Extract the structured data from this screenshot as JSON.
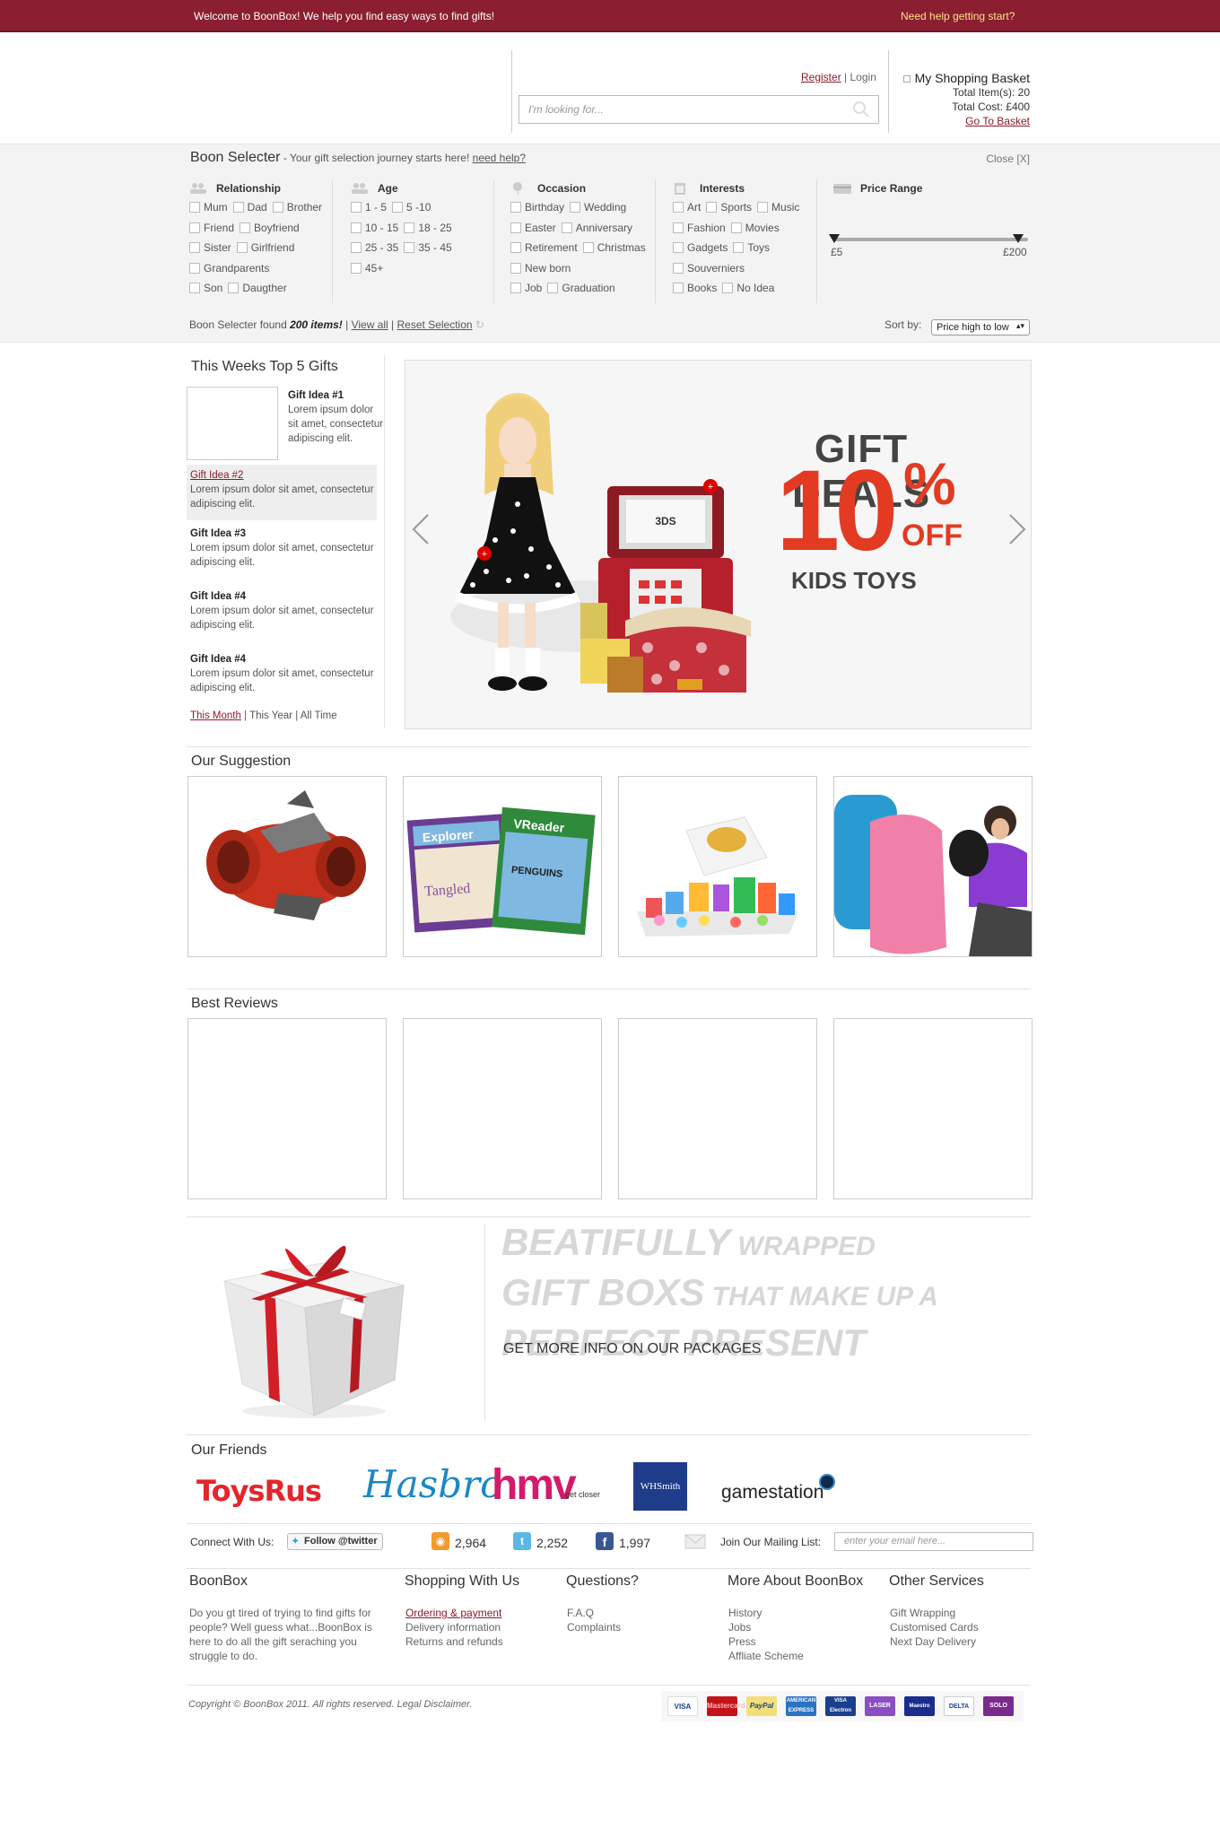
{
  "topbar": {
    "welcome": "Welcome to BoonBox! We help you find easy ways to find gifts!",
    "help": "Need help getting start?"
  },
  "header": {
    "search_placeholder": "I'm looking for...",
    "register": "Register",
    "divider": "|",
    "login": "Login",
    "basket": {
      "title": "My Shopping Basket",
      "items": "Total Item(s): 20",
      "cost": "Total Cost: £400",
      "link": "Go To Basket"
    }
  },
  "selector": {
    "title": "Boon Selecter",
    "subtitle": " - Your gift selection journey starts here! ",
    "help_link": "need help?",
    "close": "Close [X]",
    "relationship": {
      "label": "Relationship",
      "rows": [
        [
          "Mum",
          "Dad",
          "Brother"
        ],
        [
          "Friend",
          "Boyfriend"
        ],
        [
          "Sister",
          "Girlfriend"
        ],
        [
          "Grandparents"
        ],
        [
          "Son",
          "Daugther"
        ]
      ]
    },
    "age": {
      "label": "Age",
      "rows": [
        [
          "1 - 5",
          "5 -10"
        ],
        [
          "10 - 15",
          "18 - 25"
        ],
        [
          "25 - 35",
          "35 - 45"
        ],
        [
          "45+"
        ]
      ]
    },
    "occasion": {
      "label": "Occasion",
      "rows": [
        [
          "Birthday",
          "Wedding"
        ],
        [
          "Easter",
          "Anniversary"
        ],
        [
          "Retirement",
          "Christmas"
        ],
        [
          "New born"
        ],
        [
          "Job",
          "Graduation"
        ]
      ]
    },
    "interests": {
      "label": "Interests",
      "rows": [
        [
          "Art",
          "Sports",
          "Music"
        ],
        [
          "Fashion",
          "Movies"
        ],
        [
          "Gadgets",
          "Toys"
        ],
        [
          "Souverniers"
        ],
        [
          "Books",
          "No Idea"
        ]
      ]
    },
    "price": {
      "label": "Price Range",
      "min": "£5",
      "max": "£200"
    },
    "found_prefix": "Boon Selecter found ",
    "found_count": "200 items!",
    "view_all": "View all",
    "reset": "Reset Selection",
    "sort_label": "Sort by:",
    "sort_value": "Price high to low"
  },
  "top_gifts": {
    "title": "This Weeks Top 5 Gifts",
    "items": [
      {
        "title": "Gift Idea #1",
        "text": "Lorem ipsum dolor sit amet, consectetur adipiscing elit."
      },
      {
        "title": "Gift Idea #2",
        "text": "Lorem ipsum dolor sit amet, consectetur adipiscing elit."
      },
      {
        "title": "Gift Idea #3",
        "text": "Lorem ipsum dolor sit amet, consectetur adipiscing elit."
      },
      {
        "title": "Gift Idea #4",
        "text": "Lorem ipsum dolor sit amet, consectetur adipiscing elit."
      },
      {
        "title": "Gift Idea #4",
        "text": "Lorem ipsum dolor sit amet, consectetur adipiscing elit."
      }
    ],
    "filters": [
      "This Month",
      "This Year",
      "All Time"
    ]
  },
  "banner": {
    "line1": "GIFT DEALS",
    "percent": "10",
    "pct_sign": "%",
    "off": "OFF",
    "line3": "KIDS TOYS",
    "console_label": "3DS"
  },
  "suggestion": {
    "title": "Our Suggestion"
  },
  "reviews": {
    "title": "Best Reviews"
  },
  "promo": {
    "line1_big": "BEATIFULLY",
    "line1_small": " WRAPPED",
    "line2_big": "GIFT BOXS",
    "line2_small": " THAT MAKE UP A",
    "line3_big": "PERFECT PRESENT",
    "cta": "GET MORE INFO ON OUR PACKAGES"
  },
  "friends": {
    "title": "Our Friends",
    "toysrus": "ToysRus",
    "hasbro": "Hasbro",
    "hmv": "hmv",
    "hmv_tag": "get closer",
    "whsmith": "WHSmith",
    "gamestation": "gamestation"
  },
  "social": {
    "connect": "Connect With Us:",
    "twitter_btn": "Follow @twitter",
    "rss_count": "2,964",
    "tw_count": "2,252",
    "fb_count": "1,997",
    "mailing": "Join Our Mailing List:",
    "email_placeholder": "enter your email here..."
  },
  "footer": {
    "boonbox_title": "BoonBox",
    "boonbox_text": "Do you gt tired of trying to find gifts for people? Well guess what...BoonBox is here to do all the gift seraching you struggle to do.",
    "shopping_title": "Shopping With Us",
    "shopping_links": [
      "Ordering & payment",
      "Delivery information",
      "Returns and refunds"
    ],
    "questions_title": "Questions?",
    "questions_links": [
      "F.A.Q",
      "Complaints"
    ],
    "more_title": "More About BoonBox",
    "more_links": [
      "History",
      "Jobs",
      "Press",
      "Affliate Scheme"
    ],
    "other_title": "Other Services",
    "other_links": [
      "Gift Wrapping",
      "Customised Cards",
      "Next Day Delivery"
    ],
    "copyright": "Copyright © BoonBox 2011. All rights reserved. Legal Disclaimer.",
    "payments": [
      "VISA",
      "Mastercard",
      "PayPal",
      "AMERICAN EXPRESS",
      "VISA Electron",
      "LASER",
      "Maestro",
      "DELTA",
      "SOLO"
    ]
  },
  "colors": {
    "brand": "#8b1e30",
    "accent_red": "#e33a22",
    "link": "#8a1b2b"
  }
}
